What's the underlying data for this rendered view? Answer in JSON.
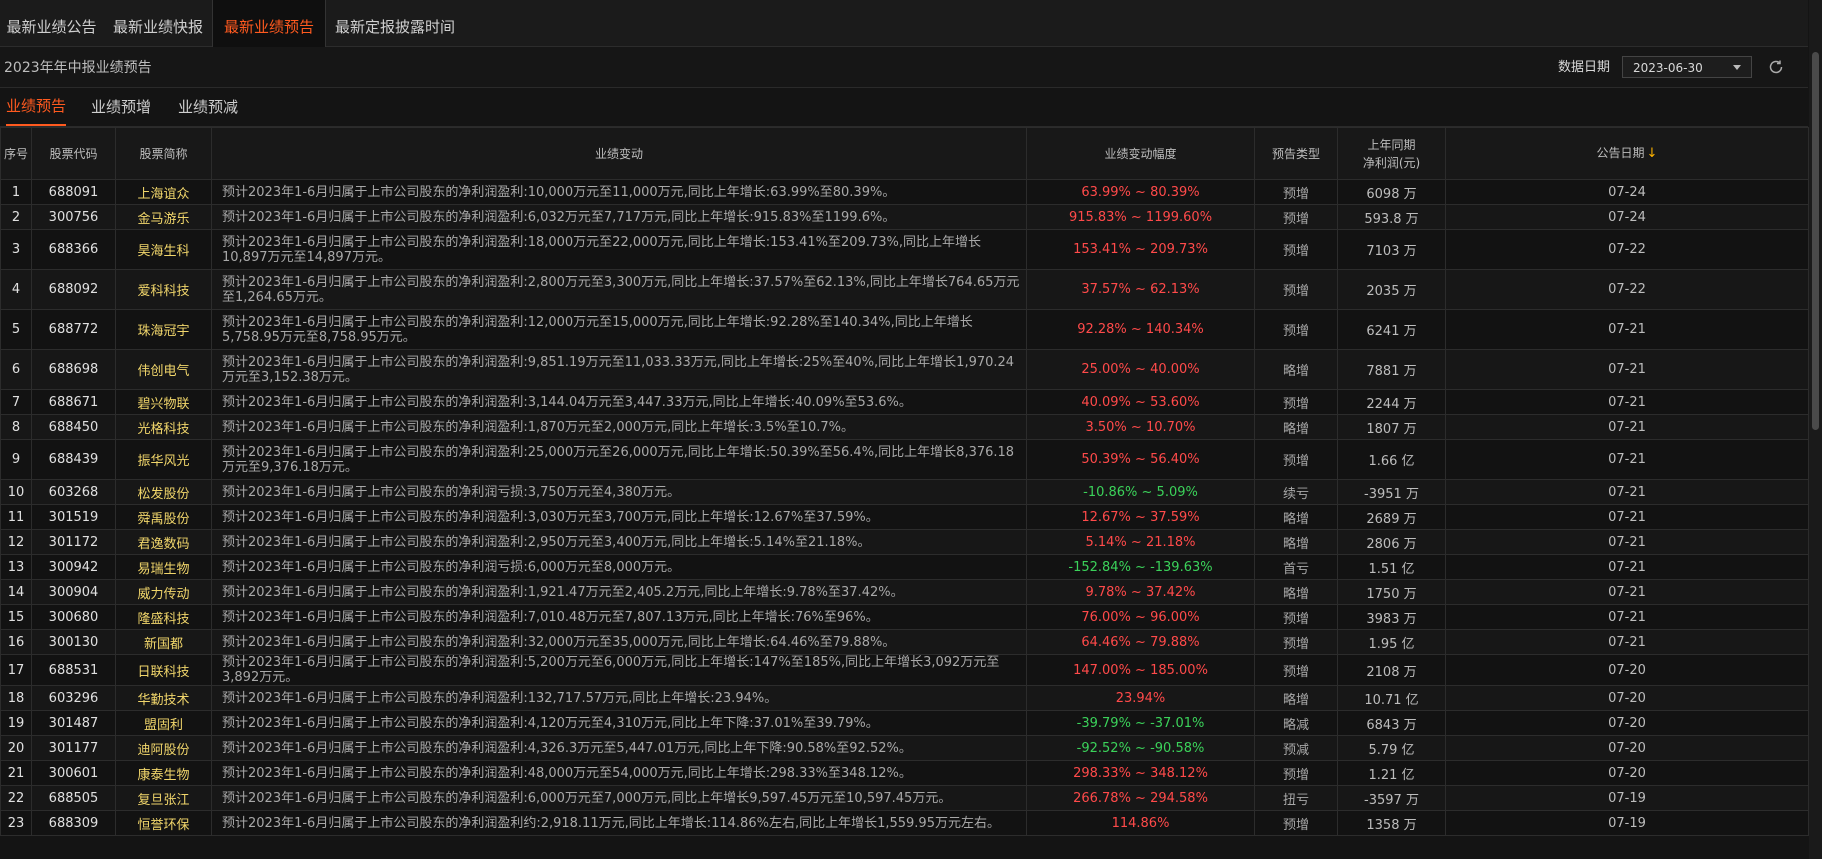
{
  "tabs": [
    "最新业绩公告",
    "最新业绩快报",
    "最新业绩预告",
    "最新定报披露时间"
  ],
  "active_tab": 2,
  "page_title": "2023年年中报业绩预告",
  "date_label": "数据日期",
  "date_value": "2023-06-30",
  "subtabs": [
    "业绩预告",
    "业绩预增",
    "业绩预减"
  ],
  "active_subtab": 0,
  "columns": {
    "seq": "序号",
    "code": "股票代码",
    "name": "股票简称",
    "desc": "业绩变动",
    "range": "业绩变动幅度",
    "type": "预告类型",
    "profit_line1": "上年同期",
    "profit_line2": "净利润(元)",
    "date": "公告日期",
    "sort_arrow": "↓"
  },
  "rows": [
    {
      "seq": "1",
      "code": "688091",
      "name": "上海谊众",
      "desc": "预计2023年1-6月归属于上市公司股东的净利润盈利:10,000万元至11,000万元,同比上年增长:63.99%至80.39%。",
      "range": "63.99% ~ 80.39%",
      "type": "预增",
      "profit": "6098 万",
      "date": "07-24"
    },
    {
      "seq": "2",
      "code": "300756",
      "name": "金马游乐",
      "desc": "预计2023年1-6月归属于上市公司股东的净利润盈利:6,032万元至7,717万元,同比上年增长:915.83%至1199.6%。",
      "range": "915.83% ~ 1199.60%",
      "type": "预增",
      "profit": "593.8 万",
      "date": "07-24"
    },
    {
      "seq": "3",
      "code": "688366",
      "name": "昊海生科",
      "desc": "预计2023年1-6月归属于上市公司股东的净利润盈利:18,000万元至22,000万元,同比上年增长:153.41%至209.73%,同比上年增长10,897万元至14,897万元。",
      "range": "153.41% ~ 209.73%",
      "type": "预增",
      "profit": "7103 万",
      "date": "07-22"
    },
    {
      "seq": "4",
      "code": "688092",
      "name": "爱科科技",
      "desc": "预计2023年1-6月归属于上市公司股东的净利润盈利:2,800万元至3,300万元,同比上年增长:37.57%至62.13%,同比上年增长764.65万元至1,264.65万元。",
      "range": "37.57% ~ 62.13%",
      "type": "预增",
      "profit": "2035 万",
      "date": "07-22"
    },
    {
      "seq": "5",
      "code": "688772",
      "name": "珠海冠宇",
      "desc": "预计2023年1-6月归属于上市公司股东的净利润盈利:12,000万元至15,000万元,同比上年增长:92.28%至140.34%,同比上年增长5,758.95万元至8,758.95万元。",
      "range": "92.28% ~ 140.34%",
      "type": "预增",
      "profit": "6241 万",
      "date": "07-21"
    },
    {
      "seq": "6",
      "code": "688698",
      "name": "伟创电气",
      "desc": "预计2023年1-6月归属于上市公司股东的净利润盈利:9,851.19万元至11,033.33万元,同比上年增长:25%至40%,同比上年增长1,970.24万元至3,152.38万元。",
      "range": "25.00% ~ 40.00%",
      "type": "略增",
      "profit": "7881 万",
      "date": "07-21"
    },
    {
      "seq": "7",
      "code": "688671",
      "name": "碧兴物联",
      "desc": "预计2023年1-6月归属于上市公司股东的净利润盈利:3,144.04万元至3,447.33万元,同比上年增长:40.09%至53.6%。",
      "range": "40.09% ~ 53.60%",
      "type": "预增",
      "profit": "2244 万",
      "date": "07-21"
    },
    {
      "seq": "8",
      "code": "688450",
      "name": "光格科技",
      "desc": "预计2023年1-6月归属于上市公司股东的净利润盈利:1,870万元至2,000万元,同比上年增长:3.5%至10.7%。",
      "range": "3.50% ~ 10.70%",
      "type": "略增",
      "profit": "1807 万",
      "date": "07-21"
    },
    {
      "seq": "9",
      "code": "688439",
      "name": "振华风光",
      "desc": "预计2023年1-6月归属于上市公司股东的净利润盈利:25,000万元至26,000万元,同比上年增长:50.39%至56.4%,同比上年增长8,376.18万元至9,376.18万元。",
      "range": "50.39% ~ 56.40%",
      "type": "预增",
      "profit": "1.66 亿",
      "date": "07-21"
    },
    {
      "seq": "10",
      "code": "603268",
      "name": "松发股份",
      "desc": "预计2023年1-6月归属于上市公司股东的净利润亏损:3,750万元至4,380万元。",
      "range": "-10.86% ~ 5.09%",
      "type": "续亏",
      "profit": "-3951 万",
      "date": "07-21"
    },
    {
      "seq": "11",
      "code": "301519",
      "name": "舜禹股份",
      "desc": "预计2023年1-6月归属于上市公司股东的净利润盈利:3,030万元至3,700万元,同比上年增长:12.67%至37.59%。",
      "range": "12.67% ~ 37.59%",
      "type": "略增",
      "profit": "2689 万",
      "date": "07-21"
    },
    {
      "seq": "12",
      "code": "301172",
      "name": "君逸数码",
      "desc": "预计2023年1-6月归属于上市公司股东的净利润盈利:2,950万元至3,400万元,同比上年增长:5.14%至21.18%。",
      "range": "5.14% ~ 21.18%",
      "type": "略增",
      "profit": "2806 万",
      "date": "07-21"
    },
    {
      "seq": "13",
      "code": "300942",
      "name": "易瑞生物",
      "desc": "预计2023年1-6月归属于上市公司股东的净利润亏损:6,000万元至8,000万元。",
      "range": "-152.84% ~ -139.63%",
      "type": "首亏",
      "profit": "1.51 亿",
      "date": "07-21"
    },
    {
      "seq": "14",
      "code": "300904",
      "name": "威力传动",
      "desc": "预计2023年1-6月归属于上市公司股东的净利润盈利:1,921.47万元至2,405.2万元,同比上年增长:9.78%至37.42%。",
      "range": "9.78% ~ 37.42%",
      "type": "略增",
      "profit": "1750 万",
      "date": "07-21"
    },
    {
      "seq": "15",
      "code": "300680",
      "name": "隆盛科技",
      "desc": "预计2023年1-6月归属于上市公司股东的净利润盈利:7,010.48万元至7,807.13万元,同比上年增长:76%至96%。",
      "range": "76.00% ~ 96.00%",
      "type": "预增",
      "profit": "3983 万",
      "date": "07-21"
    },
    {
      "seq": "16",
      "code": "300130",
      "name": "新国都",
      "desc": "预计2023年1-6月归属于上市公司股东的净利润盈利:32,000万元至35,000万元,同比上年增长:64.46%至79.88%。",
      "range": "64.46% ~ 79.88%",
      "type": "预增",
      "profit": "1.95 亿",
      "date": "07-21"
    },
    {
      "seq": "17",
      "code": "688531",
      "name": "日联科技",
      "desc": "预计2023年1-6月归属于上市公司股东的净利润盈利:5,200万元至6,000万元,同比上年增长:147%至185%,同比上年增长3,092万元至3,892万元。",
      "range": "147.00% ~ 185.00%",
      "type": "预增",
      "profit": "2108 万",
      "date": "07-20"
    },
    {
      "seq": "18",
      "code": "603296",
      "name": "华勤技术",
      "desc": "预计2023年1-6月归属于上市公司股东的净利润盈利:132,717.57万元,同比上年增长:23.94%。",
      "range": "23.94%",
      "type": "略增",
      "profit": "10.71 亿",
      "date": "07-20"
    },
    {
      "seq": "19",
      "code": "301487",
      "name": "盟固利",
      "desc": "预计2023年1-6月归属于上市公司股东的净利润盈利:4,120万元至4,310万元,同比上年下降:37.01%至39.79%。",
      "range": "-39.79% ~ -37.01%",
      "type": "略减",
      "profit": "6843 万",
      "date": "07-20"
    },
    {
      "seq": "20",
      "code": "301177",
      "name": "迪阿股份",
      "desc": "预计2023年1-6月归属于上市公司股东的净利润盈利:4,326.3万元至5,447.01万元,同比上年下降:90.58%至92.52%。",
      "range": "-92.52% ~ -90.58%",
      "type": "预减",
      "profit": "5.79 亿",
      "date": "07-20"
    },
    {
      "seq": "21",
      "code": "300601",
      "name": "康泰生物",
      "desc": "预计2023年1-6月归属于上市公司股东的净利润盈利:48,000万元至54,000万元,同比上年增长:298.33%至348.12%。",
      "range": "298.33% ~ 348.12%",
      "type": "预增",
      "profit": "1.21 亿",
      "date": "07-20"
    },
    {
      "seq": "22",
      "code": "688505",
      "name": "复旦张江",
      "desc": "预计2023年1-6月归属于上市公司股东的净利润盈利:6,000万元至7,000万元,同比上年增长9,597.45万元至10,597.45万元。",
      "range": "266.78% ~ 294.58%",
      "type": "扭亏",
      "profit": "-3597 万",
      "date": "07-19"
    },
    {
      "seq": "23",
      "code": "688309",
      "name": "恒誉环保",
      "desc": "预计2023年1-6月归属于上市公司股东的净利润盈利约:2,918.11万元,同比上年增长:114.86%左右,同比上年增长1,559.95万元左右。",
      "range": "114.86%",
      "type": "预增",
      "profit": "1358 万",
      "date": "07-19"
    }
  ]
}
